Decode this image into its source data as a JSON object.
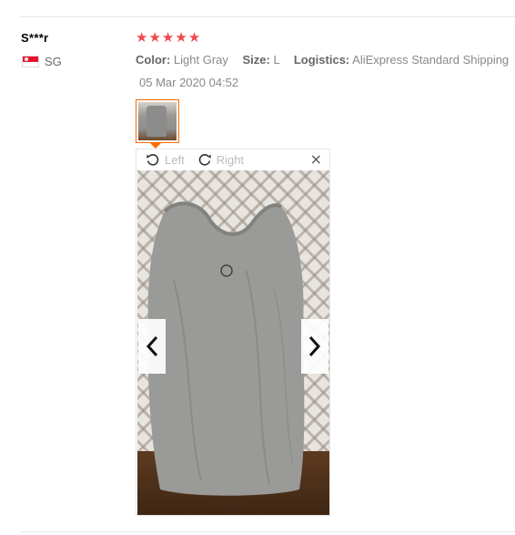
{
  "review": {
    "user_name": "S***r",
    "country_code": "SG",
    "rating": 5,
    "stars": [
      "★",
      "★",
      "★",
      "★",
      "★"
    ],
    "attributes": [
      {
        "key": "Color:",
        "value": "Light Gray"
      },
      {
        "key": "Size:",
        "value": "L"
      },
      {
        "key": "Logistics:",
        "value": "AliExpress Standard Shipping"
      }
    ],
    "date": "05 Mar 2020 04:52"
  },
  "viewer": {
    "rotate_left_label": "Left",
    "rotate_right_label": "Right",
    "close_glyph": "×",
    "prev_icon": "chevron-left-icon",
    "next_icon": "chevron-right-icon"
  },
  "colors": {
    "star": "#f0484d",
    "accent": "#ff6a00",
    "muted_text": "#888888"
  }
}
